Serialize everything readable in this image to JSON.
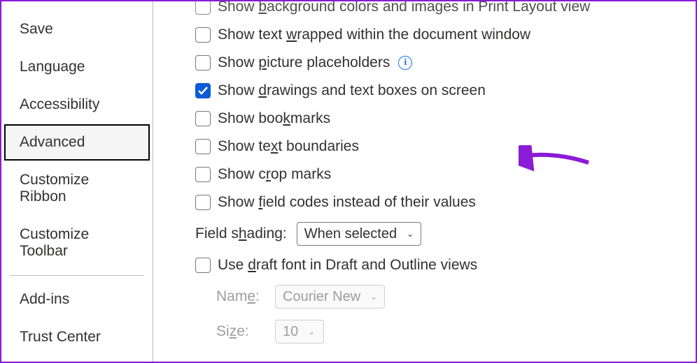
{
  "sidebar": {
    "items": [
      {
        "label": "Save"
      },
      {
        "label": "Language"
      },
      {
        "label": "Accessibility"
      },
      {
        "label": "Advanced"
      },
      {
        "label": "Customize Ribbon"
      },
      {
        "label": "Customize Toolbar"
      },
      {
        "label": "Add-ins"
      },
      {
        "label": "Trust Center"
      }
    ]
  },
  "options": {
    "bg_colors": {
      "pre": "Show ",
      "u": "b",
      "post": "ackground colors and images in Print Layout view"
    },
    "wrap": {
      "pre": "Show text ",
      "u": "w",
      "post": "rapped within the document window"
    },
    "pic": {
      "pre": "Show ",
      "u": "p",
      "post": "icture placeholders"
    },
    "drawings": {
      "pre": "Show ",
      "u": "d",
      "post": "rawings and text boxes on screen"
    },
    "bookmarks": {
      "pre": "Show boo",
      "u": "k",
      "post": "marks"
    },
    "textbound": {
      "pre": "Show te",
      "u": "x",
      "post": "t boundaries"
    },
    "crop": {
      "pre": "Show c",
      "u": "r",
      "post": "op marks"
    },
    "fieldcodes": {
      "pre": "Show ",
      "u": "f",
      "post": "ield codes instead of their values"
    },
    "draft": {
      "pre": "Use ",
      "u": "d",
      "post": "raft font in Draft and Outline views"
    }
  },
  "field_shading": {
    "label_pre": "Field s",
    "label_u": "h",
    "label_post": "ading:",
    "value": "When selected"
  },
  "draft_group": {
    "name": {
      "label_pre": "Nam",
      "label_u": "e",
      "label_post": ":",
      "value": "Courier New"
    },
    "size": {
      "label_pre": "Si",
      "label_u": "z",
      "label_post": "e:",
      "value": "10"
    }
  },
  "info_glyph": "i"
}
